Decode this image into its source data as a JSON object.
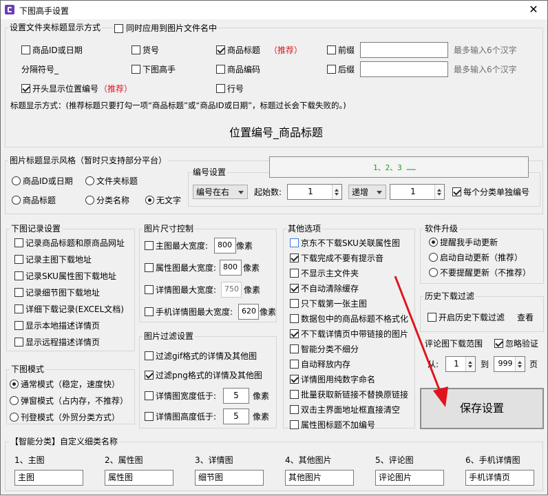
{
  "window": {
    "title": "下图高手设置",
    "close": "✕"
  },
  "folder_title": {
    "group_label": "设置文件夹标题显示方式",
    "apply_image_name": "同时应用到图片文件名中",
    "item_id_date": "商品ID或日期",
    "sku_no": "货号",
    "item_title": "商品标题",
    "recommend1": "（推荐）",
    "prefix": "前缀",
    "prefix_hint": "最多输入6个汉字",
    "separator": "分隔符号_",
    "downloader": "下图高手",
    "item_code": "商品编码",
    "suffix": "后缀",
    "suffix_hint": "最多输入6个汉字",
    "position_no": "开头显示位置编号",
    "recommend2": "（推荐）",
    "line_no": "行号",
    "explain": "标题显示方式：(推荐标题只要打勾一项“商品标题”或“商品ID或日期”，标题过长会下载失败的。)",
    "preview": "位置编号_商品标题"
  },
  "image_title": {
    "group_label": "图片标题显示风格（暂时只支持部分平台）",
    "opt_id_date": "商品ID或日期",
    "opt_folder": "文件夹标题",
    "opt_title": "商品标题",
    "opt_category": "分类名称",
    "opt_none": "无文字",
    "numbering_label": "编号设置",
    "seq_preview": "1、2、3 ……",
    "position_select": "编号在右",
    "start_label": "起始数:",
    "start_value": "1",
    "order_select": "递增",
    "step_value": "1",
    "per_category": "每个分类单独编号"
  },
  "record": {
    "group_label": "下图记录设置",
    "items": [
      "记录商品标题和原商品网址",
      "记录主图下载地址",
      "记录SKU属性图下载地址",
      "记录细节图下载地址",
      "详细下载记录(EXCEL文档)",
      "显示本地描述详情页",
      "显示远程描述详情页"
    ]
  },
  "mode": {
    "group_label": "下图模式",
    "items": [
      "通常模式（稳定，速度快）",
      "弹窗模式（占内存，不推荐）",
      "刊登模式（外贸分类方式）"
    ]
  },
  "size": {
    "group_label": "图片尺寸控制",
    "main_label": "主图最大宽度:",
    "main_value": "800",
    "main_unit": "像素",
    "attr_label": "属性图最大宽度:",
    "attr_value": "800",
    "attr_unit": "像素",
    "detail_label": "详情图最大宽度:",
    "detail_value": "750",
    "detail_unit": "像素",
    "mobile_label": "手机详情图最大宽度:",
    "mobile_value": "620",
    "mobile_unit": "像素"
  },
  "filter": {
    "group_label": "图片过滤设置",
    "gif": "过滤gif格式的详情及其他图",
    "png": "过滤png格式的详情及其他图",
    "w_label": "详情图宽度低于:",
    "w_value": "5",
    "w_unit": "像素",
    "h_label": "详情图高度低于:",
    "h_value": "5",
    "h_unit": "像素"
  },
  "other": {
    "group_label": "其他选项",
    "items": [
      "京东不下载SKU关联属性图",
      "下载完成不要有提示音",
      "不显示主文件夹",
      "不自动清除缓存",
      "只下载第一张主图",
      "数据包中的商品标题不格式化",
      "不下载详情页中带链接的图片",
      "智能分类不细分",
      "自动释放内存",
      "详情图用纯数字命名",
      "批量获取新链接不替换原链接",
      "双击主界面地址框直接清空",
      "属性图标题不加编号"
    ]
  },
  "upgrade": {
    "group_label": "软件升级",
    "items": [
      "提醒我手动更新",
      "启动自动更新（推荐）",
      "不要提醒更新（不推荐）"
    ]
  },
  "history": {
    "group_label": "历史下载过滤",
    "enable": "开启历史下载过滤",
    "view": "查看"
  },
  "review": {
    "range_label": "评论图下载范围",
    "ignore": "忽略验证",
    "from": "从:",
    "from_value": "1",
    "to": "到",
    "to_value": "999",
    "page": "页"
  },
  "save_button": "保存设置",
  "custom": {
    "group_label": "【智能分类】自定义细类名称",
    "cols": [
      {
        "label": "1、主图",
        "value": "主图"
      },
      {
        "label": "2、属性图",
        "value": "属性图"
      },
      {
        "label": "3、详情图",
        "value": "细节图"
      },
      {
        "label": "4、其他图片",
        "value": "其他图片"
      },
      {
        "label": "5、评论图",
        "value": "评论图片"
      },
      {
        "label": "6、手机详情图",
        "value": "手机详情页"
      }
    ]
  },
  "colors": {
    "recommend": "#e0141e",
    "seq_preview": "#18a018",
    "arrow": "#e0141e",
    "app_icon": "#6a3fb6"
  }
}
